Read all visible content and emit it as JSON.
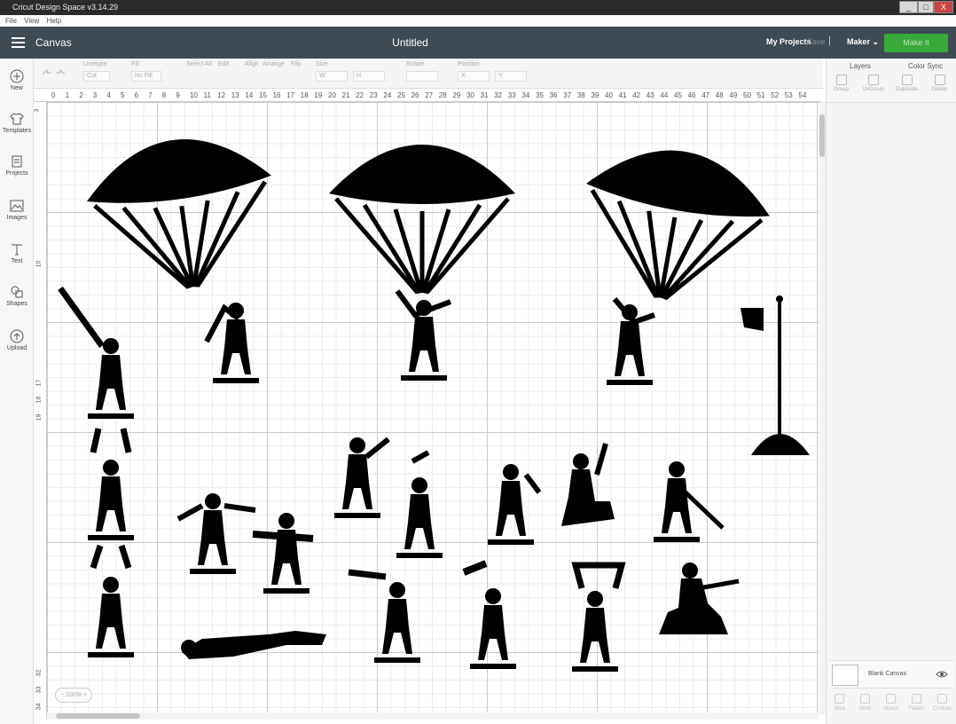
{
  "window": {
    "title": "Cricut Design Space  v3.14.29",
    "minimize": "_",
    "maximize": "□",
    "close": "X"
  },
  "menubar": [
    "File",
    "View",
    "Help"
  ],
  "header": {
    "section": "Canvas",
    "document_title": "Untitled",
    "my_projects": "My Projects",
    "save": "Save",
    "separator": "|",
    "machine": "Maker",
    "make_it": "Make It"
  },
  "toolbar": {
    "labels": [
      "Linetype",
      "Fill",
      "Select All",
      "Edit",
      "Align",
      "Arrange",
      "Flip",
      "Size",
      "Rotate",
      "Position"
    ],
    "linetype_value": "Cut",
    "fill_value": "No Fill",
    "size_w": "W",
    "size_h": "H",
    "pos_x": "X",
    "pos_y": "Y"
  },
  "sidebar": {
    "items": [
      {
        "label": "New",
        "icon": "plus-circle-icon"
      },
      {
        "label": "Templates",
        "icon": "shirt-icon"
      },
      {
        "label": "Projects",
        "icon": "projects-icon"
      },
      {
        "label": "Images",
        "icon": "image-icon"
      },
      {
        "label": "Text",
        "icon": "text-icon"
      },
      {
        "label": "Shapes",
        "icon": "shapes-icon"
      },
      {
        "label": "Upload",
        "icon": "upload-icon"
      }
    ]
  },
  "ruler": {
    "top": [
      "0",
      "1",
      "2",
      "3",
      "4",
      "5",
      "6",
      "7",
      "8",
      "9",
      "10",
      "11",
      "12",
      "13",
      "14",
      "15",
      "16",
      "17",
      "18",
      "19",
      "20",
      "21",
      "22",
      "23",
      "24",
      "25",
      "26",
      "27",
      "28",
      "29",
      "30",
      "31",
      "32",
      "33",
      "34",
      "35",
      "36",
      "37",
      "38",
      "39",
      "40",
      "41",
      "42",
      "43",
      "44",
      "45",
      "46",
      "47",
      "48",
      "49",
      "50",
      "51",
      "52",
      "53",
      "54"
    ],
    "left": [
      "3",
      "",
      "",
      "",
      "",
      "",
      "",
      "",
      "",
      "10",
      "",
      "",
      "",
      "",
      "",
      "",
      "17",
      "18",
      "19",
      "",
      "",
      "",
      "",
      "",
      "",
      "",
      "",
      "",
      "",
      "",
      "",
      "",
      "",
      "32",
      "33",
      "34"
    ]
  },
  "zoom": {
    "value": "100%",
    "minus": "−",
    "plus": "+"
  },
  "layers_panel": {
    "tabs": [
      "Layers",
      "Color Sync"
    ],
    "actions": [
      "Group",
      "UnGroup",
      "Duplicate",
      "Delete"
    ],
    "blank_canvas_label": "Blank Canvas",
    "bottom_actions": [
      "Slice",
      "Weld",
      "Attach",
      "Flatten",
      "Contour"
    ]
  },
  "colors": {
    "header_bg": "#3e4a54",
    "make_it": "#39a93a",
    "silhouette": "#000000"
  }
}
